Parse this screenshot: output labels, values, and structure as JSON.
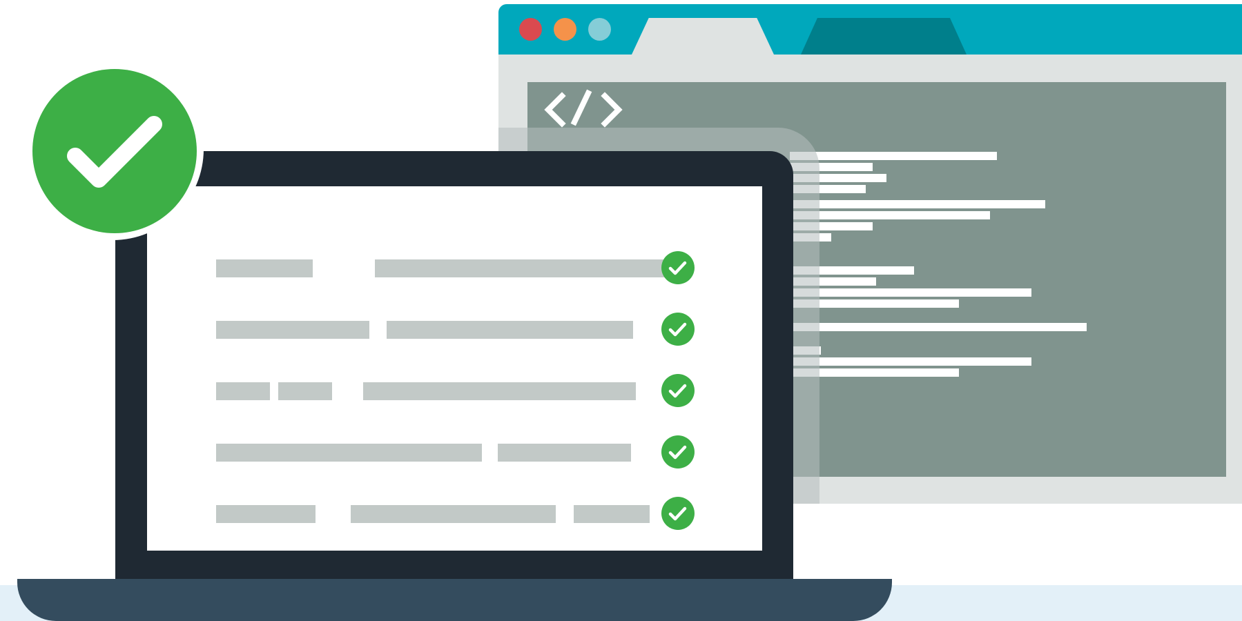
{
  "colors": {
    "window_close": "#da4a4f",
    "window_minimize": "#f5924a",
    "window_maximize": "#85cdd7",
    "browser_bar": "#00a8bc",
    "code_background": "#80948e",
    "laptop_frame": "#1f2933",
    "laptop_base": "#344c5e",
    "success_green": "#3daf46",
    "placeholder_bar": "#c2c9c7"
  },
  "icons": {
    "code_glyph": "code-brackets-icon",
    "badge": "checkmark-icon",
    "row_status": "checkmark-icon"
  },
  "checklist": {
    "rows": [
      {
        "status": "passed"
      },
      {
        "status": "passed"
      },
      {
        "status": "passed"
      },
      {
        "status": "passed"
      },
      {
        "status": "passed"
      }
    ]
  }
}
